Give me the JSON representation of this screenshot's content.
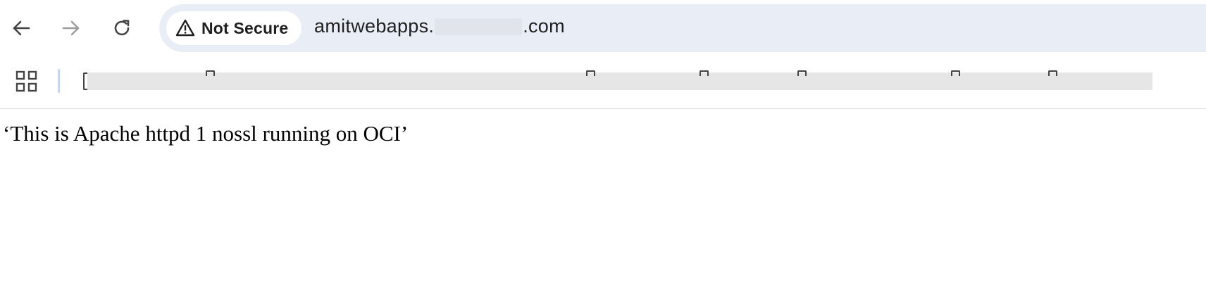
{
  "browser": {
    "back_icon": "arrow-left-icon",
    "forward_icon": "arrow-right-icon",
    "reload_icon": "reload-icon",
    "security_chip": {
      "icon": "warning-triangle-icon",
      "label": "Not Secure"
    },
    "address": {
      "prefix": "amitwebapps.",
      "suffix": ".com",
      "redacted": true
    },
    "bookmarks_bar": {
      "apps_icon": "apps-grid-icon",
      "redacted": true
    },
    "colors": {
      "omnibox_bg": "#e9eef6",
      "chip_bg": "#ffffff",
      "redaction": "#e6e6e6",
      "forward_disabled": "#9e9e9e"
    }
  },
  "page": {
    "body_text": "‘This is Apache httpd 1 nossl running on OCI’"
  }
}
